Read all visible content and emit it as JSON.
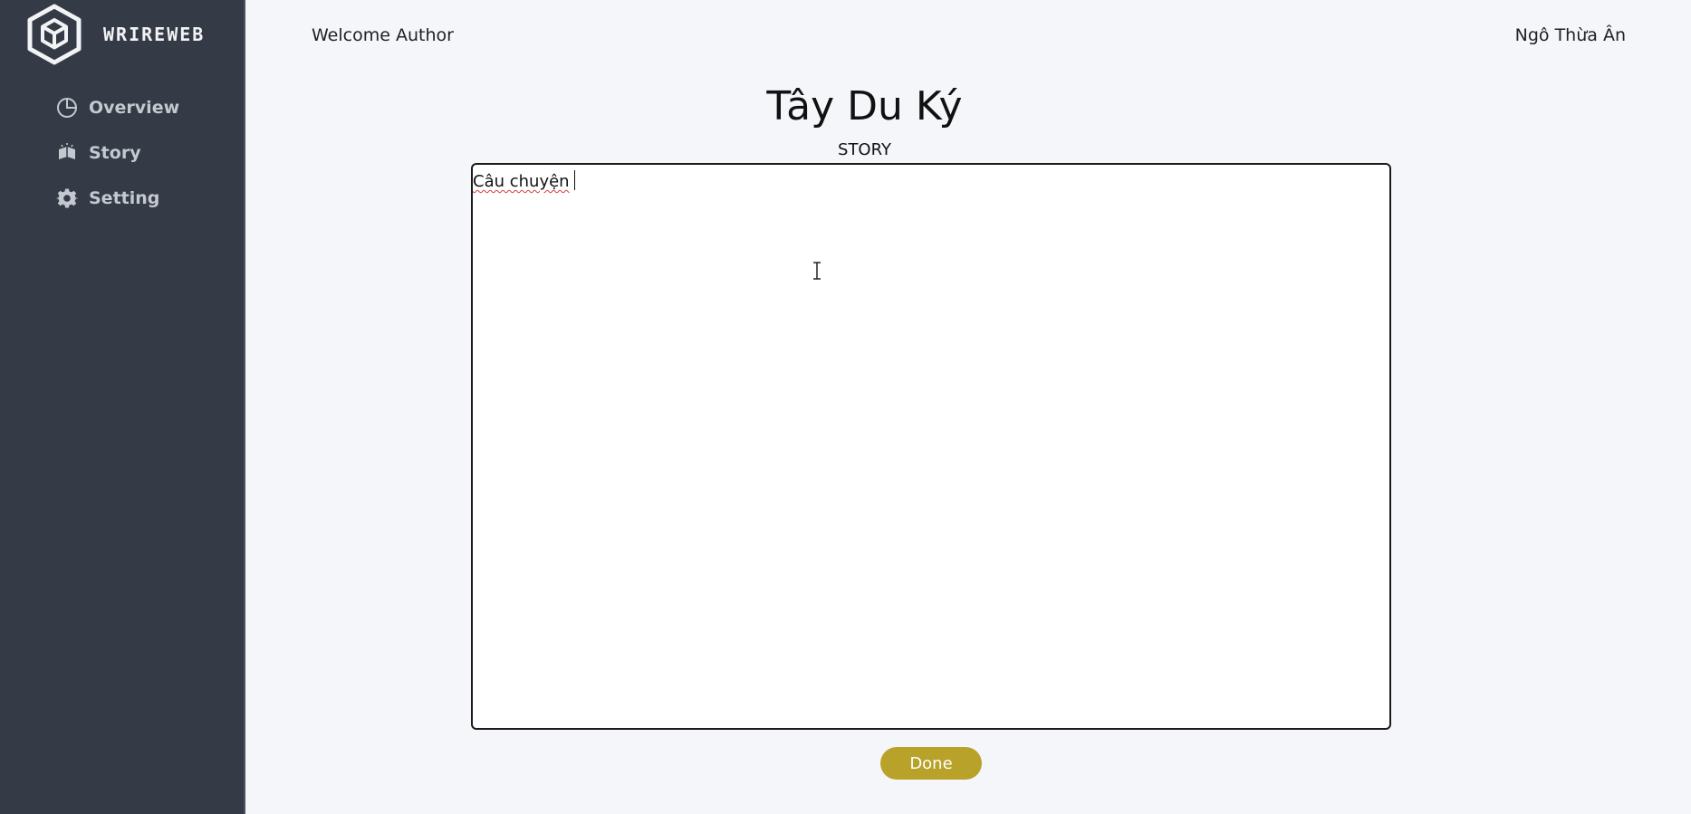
{
  "brand": {
    "name": "WRIREWEB",
    "logo_icon": "cube-hexagon-logo-icon"
  },
  "sidebar": {
    "items": [
      {
        "label": "Overview",
        "icon": "pie-chart-icon"
      },
      {
        "label": "Story",
        "icon": "book-icon"
      },
      {
        "label": "Setting",
        "icon": "gear-icon"
      }
    ]
  },
  "header": {
    "welcome": "Welcome Author",
    "username": "Ngô Thừa Ân"
  },
  "main": {
    "title": "Tây Du Ký",
    "section_label": "STORY",
    "editor_value": "Câu chuyện",
    "done_label": "Done"
  },
  "colors": {
    "sidebar_bg": "#343a46",
    "page_bg": "#f5f6fa",
    "done_button": "#b8a22a"
  }
}
